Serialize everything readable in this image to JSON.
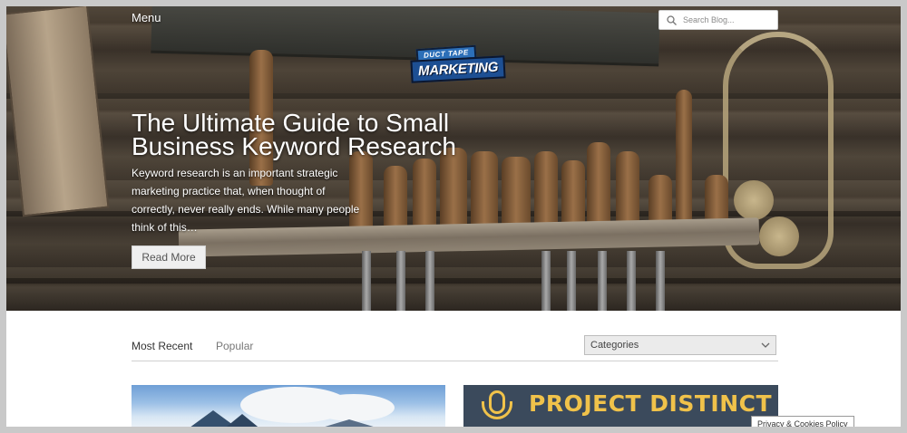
{
  "header": {
    "menu_label": "Menu",
    "search_placeholder": "Search Blog...",
    "logo_top": "DUCT TAPE",
    "logo_bottom": "MARKETING"
  },
  "hero": {
    "title": "The Ultimate Guide to Small Business Keyword Research",
    "excerpt": "Keyword research is an important strategic marketing practice that, when thought of correctly, never really ends. While many people think of this…",
    "button_label": "Read More"
  },
  "tabs": [
    {
      "label": "Most Recent",
      "active": true
    },
    {
      "label": "Popular",
      "active": false
    }
  ],
  "categories_select": {
    "selected": "Categories"
  },
  "cards": [
    {
      "image": "mountain-landscape"
    },
    {
      "title": "PROJECT DISTINCT",
      "icon": "microphone-icon"
    }
  ],
  "footer": {
    "privacy_label": "Privacy & Cookies Policy"
  },
  "colors": {
    "accent_gold": "#f0c24a",
    "logo_blue": "#1d4f93",
    "select_bg": "#ebebeb"
  }
}
